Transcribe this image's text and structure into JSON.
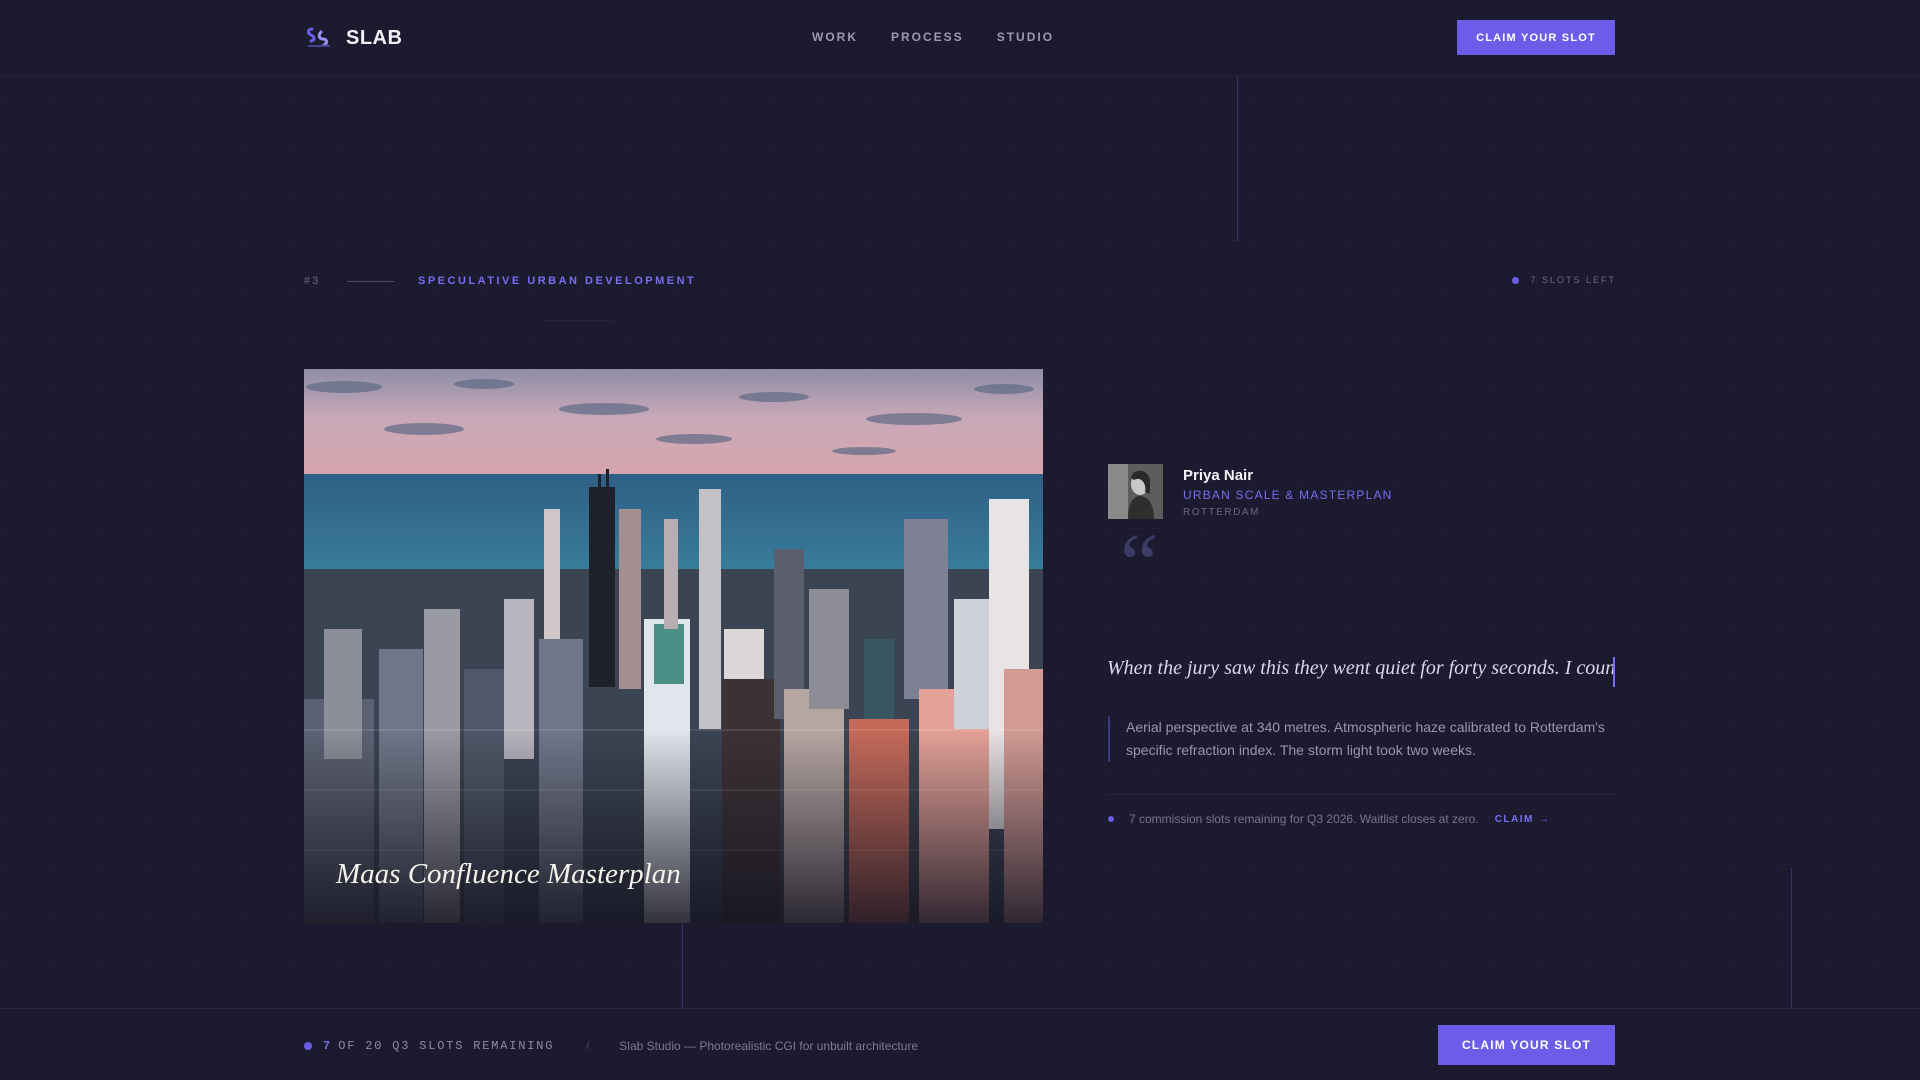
{
  "brand": {
    "name": "SLAB",
    "logo_icon": "slab-logo-icon"
  },
  "nav": {
    "items": [
      "WORK",
      "PROCESS",
      "STUDIO"
    ]
  },
  "header": {
    "cta_label": "CLAIM YOUR SLOT"
  },
  "project": {
    "index": "#3",
    "category": "SPECULATIVE URBAN DEVELOPMENT",
    "slots_left": "7 SLOTS LEFT",
    "title": "Maas Confluence Masterplan"
  },
  "testimonial": {
    "name": "Priya Nair",
    "role": "URBAN SCALE & MASTERPLAN",
    "city": "ROTTERDAM",
    "quote_mark": "“",
    "quote": "When the jury saw this they went quiet for forty seconds. I coun",
    "description": "Aerial perspective at 340 metres. Atmospheric haze calibrated to Rotterdam's specific refraction index. The storm light took two weeks."
  },
  "commission": {
    "text": "7 commission slots remaining for Q3 2026. Waitlist closes at zero.",
    "claim_label": "CLAIM",
    "arrow": "→"
  },
  "footer": {
    "count": "7",
    "count_label": "OF 20 Q3 SLOTS REMAINING",
    "separator": "/",
    "tagline": "Slab Studio — Photorealistic CGI for unbuilt architecture",
    "cta_label": "CLAIM YOUR SLOT"
  },
  "colors": {
    "accent": "#6c5ce7",
    "background": "#1b1a2e"
  }
}
